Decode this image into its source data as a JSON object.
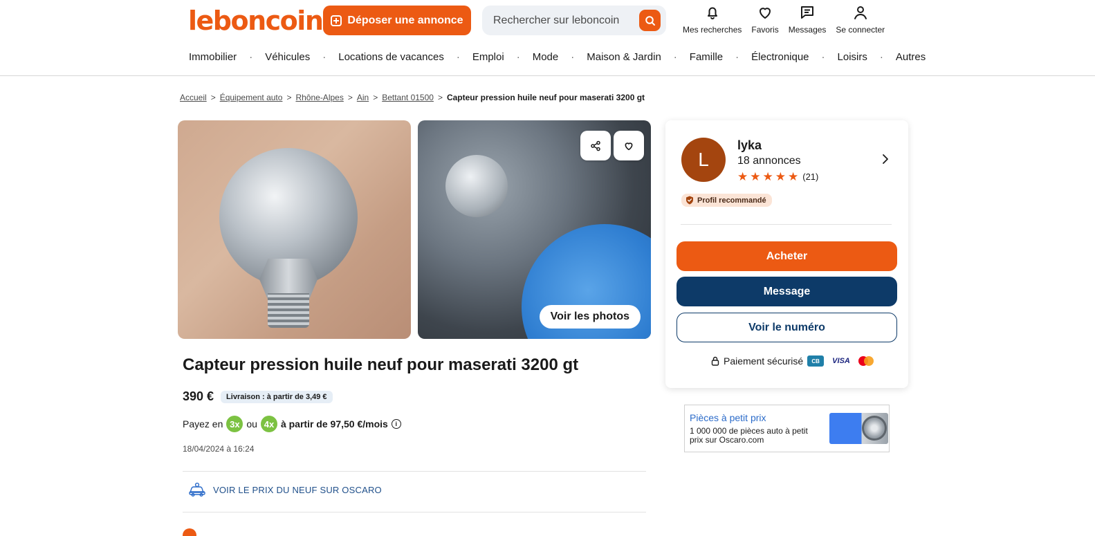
{
  "header": {
    "logo": "leboncoin",
    "post_button": "Déposer une annonce",
    "search_placeholder": "Rechercher sur leboncoin",
    "icons": [
      {
        "label": "Mes recherches",
        "icon": "bell-icon"
      },
      {
        "label": "Favoris",
        "icon": "heart-icon"
      },
      {
        "label": "Messages",
        "icon": "message-icon"
      },
      {
        "label": "Se connecter",
        "icon": "user-icon"
      }
    ]
  },
  "nav": [
    "Immobilier",
    "Véhicules",
    "Locations de vacances",
    "Emploi",
    "Mode",
    "Maison & Jardin",
    "Famille",
    "Électronique",
    "Loisirs",
    "Autres"
  ],
  "nav_separator": "·",
  "breadcrumb": {
    "items": [
      "Accueil",
      "Équipement auto",
      "Rhône-Alpes",
      "Ain",
      "Bettant 01500"
    ],
    "current": "Capteur pression huile neuf pour maserati 3200 gt",
    "separator": ">"
  },
  "gallery": {
    "voir_photos": "Voir les photos"
  },
  "listing": {
    "title": "Capteur pression huile neuf pour maserati 3200 gt",
    "price": "390 €",
    "delivery": "Livraison : à partir de 3,49 €",
    "pay_prefix": "Payez en",
    "pay_3x": "3x",
    "pay_or": "ou",
    "pay_4x": "4x",
    "pay_suffix": "à partir de 97,50 €/mois",
    "info_glyph": "i",
    "date": "18/04/2024 à 16:24",
    "oscaro_link": "VOIR LE PRIX DU NEUF SUR OSCARO"
  },
  "seller": {
    "initial": "L",
    "name": "lyka",
    "ads_count": "18 annonces",
    "rating_count": "(21)",
    "stars": 5,
    "badge": "Profil recommandé",
    "buy_button": "Acheter",
    "message_button": "Message",
    "phone_button": "Voir le numéro",
    "secure_payment": "Paiement sécurisé",
    "card_cb": "CB",
    "card_visa": "VISA"
  },
  "ad": {
    "title": "Pièces à petit prix",
    "text": "1 000 000 de pièces auto à petit prix sur Oscaro.com"
  },
  "colors": {
    "brand_orange": "#ec5a13",
    "navy": "#0d3a68",
    "pay_green": "#7cc242"
  }
}
